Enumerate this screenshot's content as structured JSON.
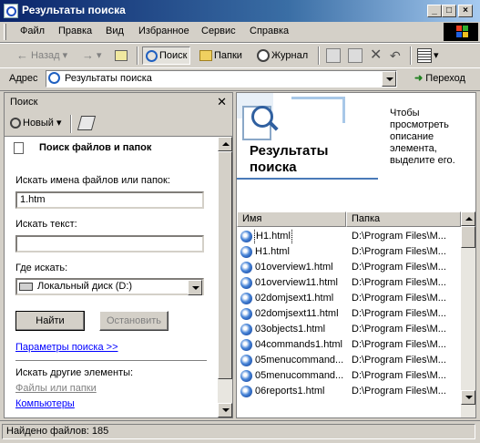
{
  "window": {
    "title": "Результаты поиска"
  },
  "menu": [
    {
      "label": "Файл"
    },
    {
      "label": "Правка"
    },
    {
      "label": "Вид"
    },
    {
      "label": "Избранное"
    },
    {
      "label": "Сервис"
    },
    {
      "label": "Справка"
    }
  ],
  "toolbar": {
    "back": "Назад",
    "search": "Поиск",
    "folders": "Папки",
    "history": "Журнал"
  },
  "address": {
    "label": "Адрес",
    "value": "Результаты поиска",
    "go": "Переход"
  },
  "search_pane": {
    "title": "Поиск",
    "new_label": "Новый",
    "heading": "Поиск файлов и папок",
    "names_label": "Искать имена файлов или папок:",
    "names_value": "1.htm",
    "text_label": "Искать текст:",
    "text_value": "",
    "where_label": "Где искать:",
    "where_value": "Локальный диск (D:)",
    "find_button": "Найти",
    "stop_button": "Остановить",
    "options_link": "Параметры поиска >>",
    "other_label": "Искать другие элементы:",
    "other_items": [
      "Файлы или папки",
      "Компьютеры"
    ]
  },
  "results": {
    "banner_title": "Результаты поиска",
    "banner_hint": "Чтобы просмотреть описание элемента, выделите его.",
    "columns": [
      "Имя",
      "Папка"
    ],
    "rows": [
      {
        "name": "H1.html",
        "folder": "D:\\Program Files\\M..."
      },
      {
        "name": "H1.html",
        "folder": "D:\\Program Files\\M..."
      },
      {
        "name": "01overview1.html",
        "folder": "D:\\Program Files\\M..."
      },
      {
        "name": "01overview11.html",
        "folder": "D:\\Program Files\\M..."
      },
      {
        "name": "02domjsext1.html",
        "folder": "D:\\Program Files\\M..."
      },
      {
        "name": "02domjsext11.html",
        "folder": "D:\\Program Files\\M..."
      },
      {
        "name": "03objects1.html",
        "folder": "D:\\Program Files\\M..."
      },
      {
        "name": "04commands1.html",
        "folder": "D:\\Program Files\\M..."
      },
      {
        "name": "05menucommand...",
        "folder": "D:\\Program Files\\M..."
      },
      {
        "name": "05menucommand...",
        "folder": "D:\\Program Files\\M..."
      },
      {
        "name": "06reports1.html",
        "folder": "D:\\Program Files\\M..."
      }
    ]
  },
  "status": {
    "text": "Найдено файлов: 185"
  }
}
